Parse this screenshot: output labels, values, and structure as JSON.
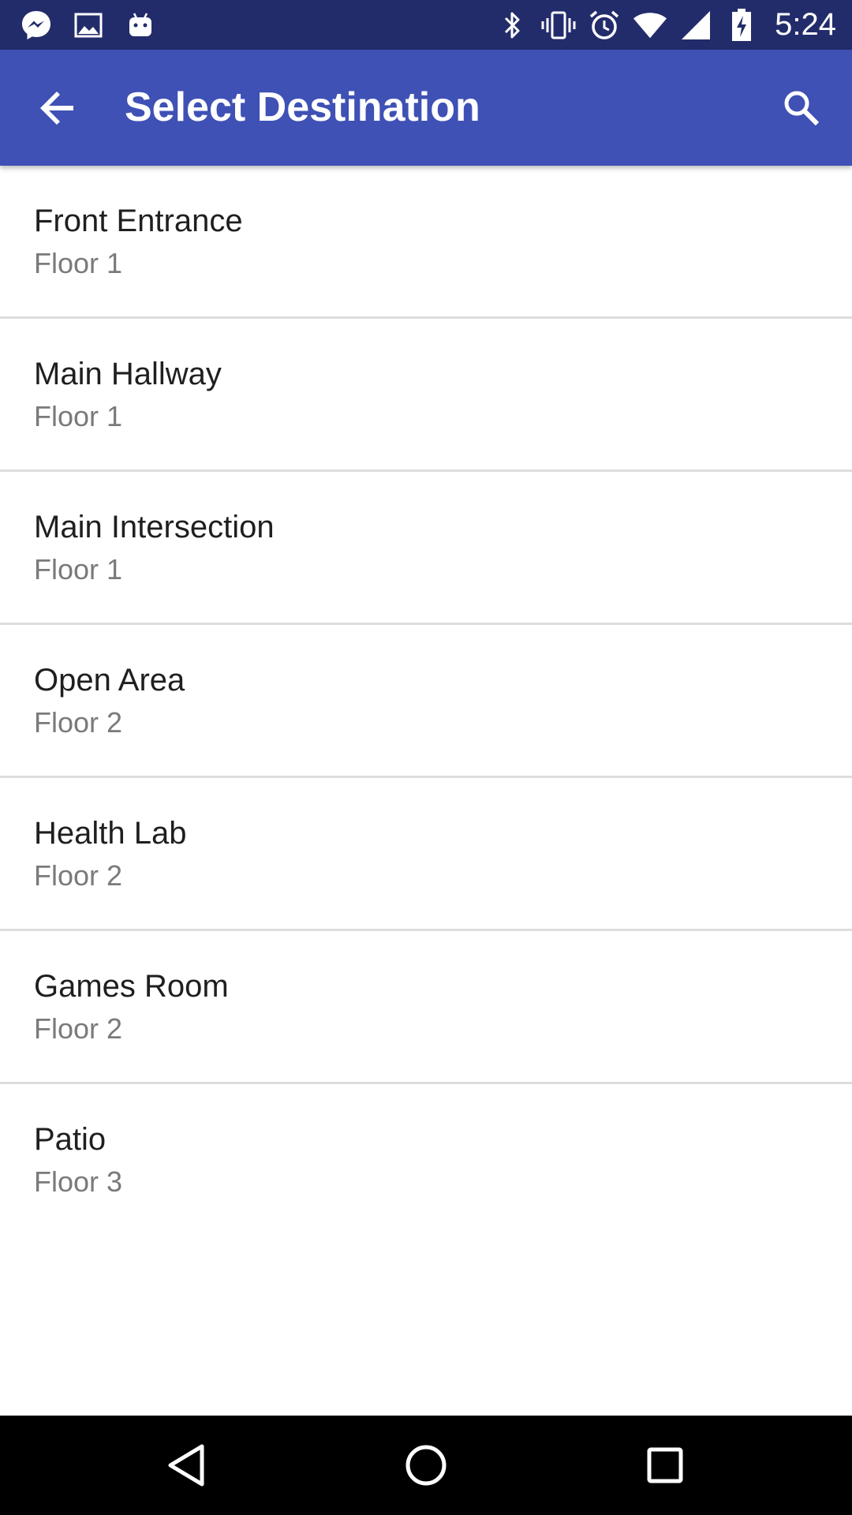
{
  "status_bar": {
    "time": "5:24",
    "left_icons": [
      "messenger-icon",
      "image-icon",
      "android-icon"
    ],
    "right_icons": [
      "bluetooth-icon",
      "vibrate-icon",
      "alarm-icon",
      "wifi-icon",
      "signal-icon",
      "battery-icon"
    ]
  },
  "app_bar": {
    "title": "Select Destination",
    "back_icon": "arrow-back-icon",
    "search_icon": "search-icon",
    "color": "#3F51B5"
  },
  "destinations": [
    {
      "name": "Front Entrance",
      "floor": "Floor 1"
    },
    {
      "name": "Main Hallway",
      "floor": "Floor 1"
    },
    {
      "name": "Main Intersection",
      "floor": "Floor 1"
    },
    {
      "name": "Open Area",
      "floor": "Floor 2"
    },
    {
      "name": "Health Lab",
      "floor": "Floor 2"
    },
    {
      "name": "Games Room",
      "floor": "Floor 2"
    },
    {
      "name": "Patio",
      "floor": "Floor 3"
    }
  ],
  "nav_bar": {
    "buttons": [
      "back-triangle-icon",
      "home-circle-icon",
      "recents-square-icon"
    ]
  },
  "colors": {
    "status_bar": "#232C6B",
    "app_bar": "#3F51B5",
    "divider": "#DDDDDD",
    "primary_text": "#1f1f1f",
    "secondary_text": "#7a7a7a"
  }
}
